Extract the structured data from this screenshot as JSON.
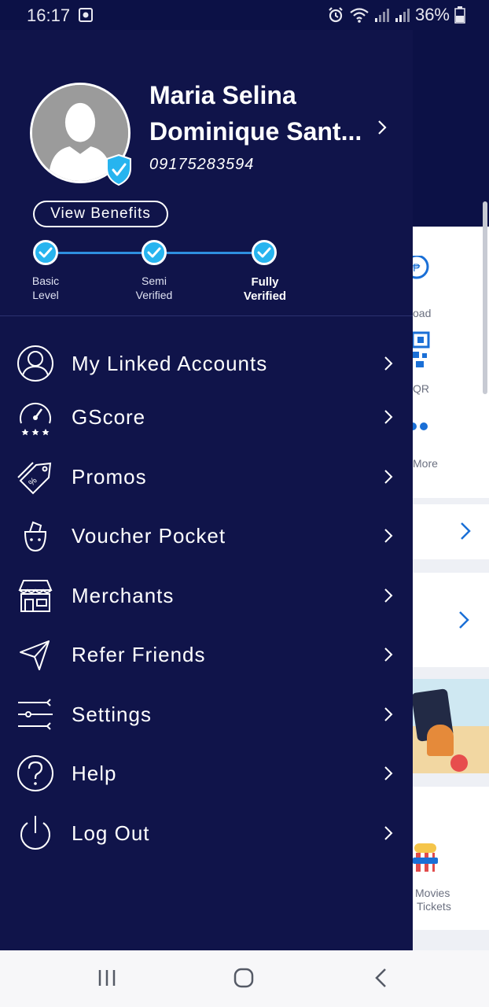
{
  "status_bar": {
    "time": "16:17",
    "battery": "36%",
    "icons": [
      "nfc-icon",
      "alarm-icon",
      "wifi-icon",
      "signal-icon",
      "signal-icon",
      "battery-icon"
    ]
  },
  "profile": {
    "name_line1": "Maria Selina",
    "name_line2": "Dominique Sant...",
    "phone": "09175283594",
    "view_benefits_label": "View Benefits"
  },
  "verification_steps": [
    {
      "line1": "Basic",
      "line2": "Level",
      "completed": true,
      "current": false
    },
    {
      "line1": "Semi",
      "line2": "Verified",
      "completed": true,
      "current": false
    },
    {
      "line1": "Fully",
      "line2": "Verified",
      "completed": true,
      "current": true
    }
  ],
  "menu": [
    {
      "label": "My Linked Accounts",
      "icon": "linked-accounts-icon"
    },
    {
      "label": "GScore",
      "icon": "gscore-gauge-icon"
    },
    {
      "label": "Promos",
      "icon": "promo-tag-icon"
    },
    {
      "label": "Voucher Pocket",
      "icon": "voucher-pocket-icon"
    },
    {
      "label": "Merchants",
      "icon": "merchant-store-icon"
    },
    {
      "label": "Refer Friends",
      "icon": "paper-plane-icon"
    },
    {
      "label": "Settings",
      "icon": "settings-sliders-icon"
    },
    {
      "label": "Help",
      "icon": "help-question-icon"
    },
    {
      "label": "Log Out",
      "icon": "power-icon"
    }
  ],
  "background_app": {
    "labels": [
      "oad",
      "QR",
      "More",
      "Movies",
      "Tickets"
    ]
  },
  "colors": {
    "drawer_bg": "#10144a",
    "accent": "#27b4ef",
    "text": "#ffffff"
  }
}
